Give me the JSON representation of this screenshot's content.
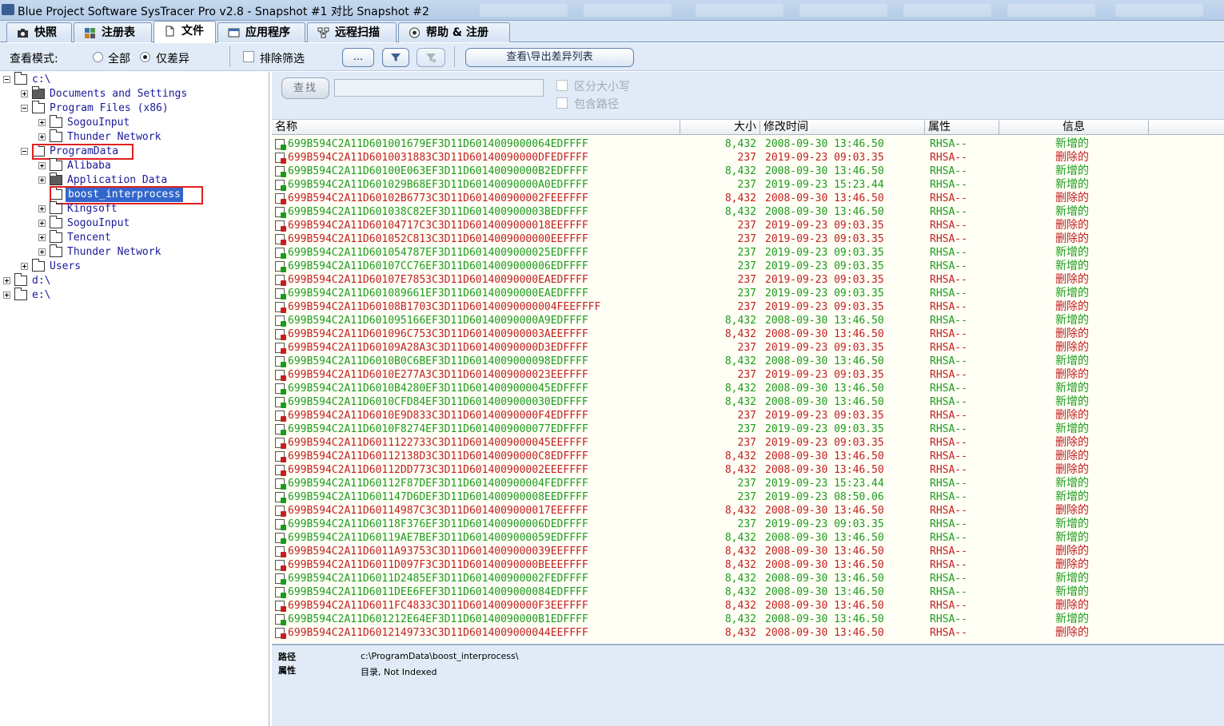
{
  "window": {
    "title": "Blue Project Software SysTracer Pro v2.8 - Snapshot #1 对比 Snapshot #2"
  },
  "tabs": [
    {
      "label": "快照",
      "icon": "camera-icon"
    },
    {
      "label": "注册表",
      "icon": "registry-icon"
    },
    {
      "label": "文件",
      "icon": "file-icon",
      "active": true
    },
    {
      "label": "应用程序",
      "icon": "application-icon"
    },
    {
      "label": "远程扫描",
      "icon": "network-icon"
    },
    {
      "label": "帮助 & 注册",
      "icon": "help-icon"
    }
  ],
  "toolbar": {
    "view_mode_label": "查看模式:",
    "all_label": "全部",
    "diff_only_label": "仅差异",
    "selected_mode": "diff_only",
    "exclude_filter_label": "排除筛选",
    "more_button_label": "...",
    "export_button_label": "查看\\导出差异列表"
  },
  "tree": {
    "items": [
      {
        "label": "c:\\",
        "expanded": true
      },
      {
        "label": "Documents and Settings",
        "expanded": false
      },
      {
        "label": "Program Files (x86)",
        "expanded": true
      },
      {
        "label": "SogouInput",
        "expanded": false
      },
      {
        "label": "Thunder Network",
        "expanded": false
      },
      {
        "label": "ProgramData",
        "expanded": true,
        "highlighted": true
      },
      {
        "label": "Alibaba",
        "expanded": false
      },
      {
        "label": "Application Data",
        "expanded": false
      },
      {
        "label": "boost_interprocess",
        "selected": true,
        "highlighted": true
      },
      {
        "label": "Kingsoft",
        "expanded": false
      },
      {
        "label": "SogouInput",
        "expanded": false
      },
      {
        "label": "Tencent",
        "expanded": false
      },
      {
        "label": "Thunder Network",
        "expanded": false
      },
      {
        "label": "Users",
        "expanded": false
      },
      {
        "label": "d:\\",
        "expanded": false
      },
      {
        "label": "e:\\",
        "expanded": false
      }
    ]
  },
  "search": {
    "find_button_label": "查找",
    "find_value": "",
    "case_sensitive_label": "区分大小写",
    "include_path_label": "包含路径"
  },
  "list": {
    "columns": [
      "名称",
      "大小",
      "修改时间",
      "属性",
      "信息"
    ],
    "rows": [
      {
        "name": "699B594C2A11D601001679EF3D11D6014009000064EDFFFF",
        "size": "8,432",
        "time": "2008-09-30 13:46.50",
        "attr": "RHSA--",
        "info": "新增的",
        "status": "added"
      },
      {
        "name": "699B594C2A11D6010031883C3D11D60140090000DFEDFFFF",
        "size": "237",
        "time": "2019-09-23 09:03.35",
        "attr": "RHSA--",
        "info": "删除的",
        "status": "deleted"
      },
      {
        "name": "699B594C2A11D60100E063EF3D11D60140090000B2EDFFFF",
        "size": "8,432",
        "time": "2008-09-30 13:46.50",
        "attr": "RHSA--",
        "info": "新增的",
        "status": "added"
      },
      {
        "name": "699B594C2A11D601029B68EF3D11D60140090000A0EDFFFF",
        "size": "237",
        "time": "2019-09-23 15:23.44",
        "attr": "RHSA--",
        "info": "新增的",
        "status": "added"
      },
      {
        "name": "699B594C2A11D60102B6773C3D11D601400900002FEEFFFF",
        "size": "8,432",
        "time": "2008-09-30 13:46.50",
        "attr": "RHSA--",
        "info": "删除的",
        "status": "deleted"
      },
      {
        "name": "699B594C2A11D601038C82EF3D11D601400900003BEDFFFF",
        "size": "8,432",
        "time": "2008-09-30 13:46.50",
        "attr": "RHSA--",
        "info": "新增的",
        "status": "added"
      },
      {
        "name": "699B594C2A11D60104717C3C3D11D6014009000018EEFFFF",
        "size": "237",
        "time": "2019-09-23 09:03.35",
        "attr": "RHSA--",
        "info": "删除的",
        "status": "deleted"
      },
      {
        "name": "699B594C2A11D601052C813C3D11D6014009000000EEFFFF",
        "size": "237",
        "time": "2019-09-23 09:03.35",
        "attr": "RHSA--",
        "info": "删除的",
        "status": "deleted"
      },
      {
        "name": "699B594C2A11D601054787EF3D11D6014009000025EDFFFF",
        "size": "237",
        "time": "2019-09-23 09:03.35",
        "attr": "RHSA--",
        "info": "新增的",
        "status": "added"
      },
      {
        "name": "699B594C2A11D60107CC76EF3D11D6014009000006EDFFFF",
        "size": "237",
        "time": "2019-09-23 09:03.35",
        "attr": "RHSA--",
        "info": "新增的",
        "status": "added"
      },
      {
        "name": "699B594C2A11D60107E7853C3D11D60140090000EAEDFFFF",
        "size": "237",
        "time": "2019-09-23 09:03.35",
        "attr": "RHSA--",
        "info": "删除的",
        "status": "deleted"
      },
      {
        "name": "699B594C2A11D601089661EF3D11D60140090000EAEDFFFF",
        "size": "237",
        "time": "2019-09-23 09:03.35",
        "attr": "RHSA--",
        "info": "新增的",
        "status": "added"
      },
      {
        "name": "699B594C2A11D60108B1703C3D11D60140090000004FEEFFFF",
        "size": "237",
        "time": "2019-09-23 09:03.35",
        "attr": "RHSA--",
        "info": "删除的",
        "status": "deleted"
      },
      {
        "name": "699B594C2A11D601095166EF3D11D60140090000A9EDFFFF",
        "size": "8,432",
        "time": "2008-09-30 13:46.50",
        "attr": "RHSA--",
        "info": "新增的",
        "status": "added"
      },
      {
        "name": "699B594C2A11D601096C753C3D11D601400900003AEEFFFF",
        "size": "8,432",
        "time": "2008-09-30 13:46.50",
        "attr": "RHSA--",
        "info": "删除的",
        "status": "deleted"
      },
      {
        "name": "699B594C2A11D60109A28A3C3D11D60140090000D3EDFFFF",
        "size": "237",
        "time": "2019-09-23 09:03.35",
        "attr": "RHSA--",
        "info": "删除的",
        "status": "deleted"
      },
      {
        "name": "699B594C2A11D6010B0C6BEF3D11D6014009000098EDFFFF",
        "size": "8,432",
        "time": "2008-09-30 13:46.50",
        "attr": "RHSA--",
        "info": "新增的",
        "status": "added"
      },
      {
        "name": "699B594C2A11D6010E277A3C3D11D6014009000023EEFFFF",
        "size": "237",
        "time": "2019-09-23 09:03.35",
        "attr": "RHSA--",
        "info": "删除的",
        "status": "deleted"
      },
      {
        "name": "699B594C2A11D6010B4280EF3D11D6014009000045EDFFFF",
        "size": "8,432",
        "time": "2008-09-30 13:46.50",
        "attr": "RHSA--",
        "info": "新增的",
        "status": "added"
      },
      {
        "name": "699B594C2A11D6010CFD84EF3D11D6014009000030EDFFFF",
        "size": "8,432",
        "time": "2008-09-30 13:46.50",
        "attr": "RHSA--",
        "info": "新增的",
        "status": "added"
      },
      {
        "name": "699B594C2A11D6010E9D833C3D11D60140090000F4EDFFFF",
        "size": "237",
        "time": "2019-09-23 09:03.35",
        "attr": "RHSA--",
        "info": "删除的",
        "status": "deleted"
      },
      {
        "name": "699B594C2A11D6010F8274EF3D11D6014009000077EDFFFF",
        "size": "237",
        "time": "2019-09-23 09:03.35",
        "attr": "RHSA--",
        "info": "新增的",
        "status": "added"
      },
      {
        "name": "699B594C2A11D6011122733C3D11D6014009000045EEFFFF",
        "size": "237",
        "time": "2019-09-23 09:03.35",
        "attr": "RHSA--",
        "info": "删除的",
        "status": "deleted"
      },
      {
        "name": "699B594C2A11D60112138D3C3D11D60140090000C8EDFFFF",
        "size": "8,432",
        "time": "2008-09-30 13:46.50",
        "attr": "RHSA--",
        "info": "删除的",
        "status": "deleted"
      },
      {
        "name": "699B594C2A11D60112DD773C3D11D601400900002EEEFFFF",
        "size": "8,432",
        "time": "2008-09-30 13:46.50",
        "attr": "RHSA--",
        "info": "删除的",
        "status": "deleted"
      },
      {
        "name": "699B594C2A11D60112F87DEF3D11D601400900004FEDFFFF",
        "size": "237",
        "time": "2019-09-23 15:23.44",
        "attr": "RHSA--",
        "info": "新增的",
        "status": "added"
      },
      {
        "name": "699B594C2A11D601147D6DEF3D11D601400900008EEDFFFF",
        "size": "237",
        "time": "2019-09-23 08:50.06",
        "attr": "RHSA--",
        "info": "新增的",
        "status": "added"
      },
      {
        "name": "699B594C2A11D60114987C3C3D11D6014009000017EEFFFF",
        "size": "8,432",
        "time": "2008-09-30 13:46.50",
        "attr": "RHSA--",
        "info": "删除的",
        "status": "deleted"
      },
      {
        "name": "699B594C2A11D60118F376EF3D11D601400900006DEDFFFF",
        "size": "237",
        "time": "2019-09-23 09:03.35",
        "attr": "RHSA--",
        "info": "新增的",
        "status": "added"
      },
      {
        "name": "699B594C2A11D60119AE7BEF3D11D6014009000059EDFFFF",
        "size": "8,432",
        "time": "2008-09-30 13:46.50",
        "attr": "RHSA--",
        "info": "新增的",
        "status": "added"
      },
      {
        "name": "699B594C2A11D6011A93753C3D11D6014009000039EEFFFF",
        "size": "8,432",
        "time": "2008-09-30 13:46.50",
        "attr": "RHSA--",
        "info": "删除的",
        "status": "deleted"
      },
      {
        "name": "699B594C2A11D6011D097F3C3D11D60140090000BEEEFFFF",
        "size": "8,432",
        "time": "2008-09-30 13:46.50",
        "attr": "RHSA--",
        "info": "删除的",
        "status": "deleted"
      },
      {
        "name": "699B594C2A11D6011D2485EF3D11D601400900002FEDFFFF",
        "size": "8,432",
        "time": "2008-09-30 13:46.50",
        "attr": "RHSA--",
        "info": "新增的",
        "status": "added"
      },
      {
        "name": "699B594C2A11D6011DEE6FEF3D11D6014009000084EDFFFF",
        "size": "8,432",
        "time": "2008-09-30 13:46.50",
        "attr": "RHSA--",
        "info": "新增的",
        "status": "added"
      },
      {
        "name": "699B594C2A11D6011FC4833C3D11D60140090000F3EEFFFF",
        "size": "8,432",
        "time": "2008-09-30 13:46.50",
        "attr": "RHSA--",
        "info": "删除的",
        "status": "deleted"
      },
      {
        "name": "699B594C2A11D601212E64EF3D11D60140090000B1EDFFFF",
        "size": "8,432",
        "time": "2008-09-30 13:46.50",
        "attr": "RHSA--",
        "info": "新增的",
        "status": "added"
      },
      {
        "name": "699B594C2A11D6012149733C3D11D6014009000044EEFFFF",
        "size": "8,432",
        "time": "2008-09-30 13:46.50",
        "attr": "RHSA--",
        "info": "删除的",
        "status": "deleted"
      }
    ]
  },
  "details": {
    "path_label": "路径",
    "path_value": "c:\\ProgramData\\boost_interprocess\\",
    "attr_label": "属性",
    "attr_value": "目录, Not Indexed"
  },
  "colors": {
    "added": "#1c9b1c",
    "deleted": "#c11f1f",
    "highlight_box": "#e02020",
    "selection": "#3366cc"
  }
}
